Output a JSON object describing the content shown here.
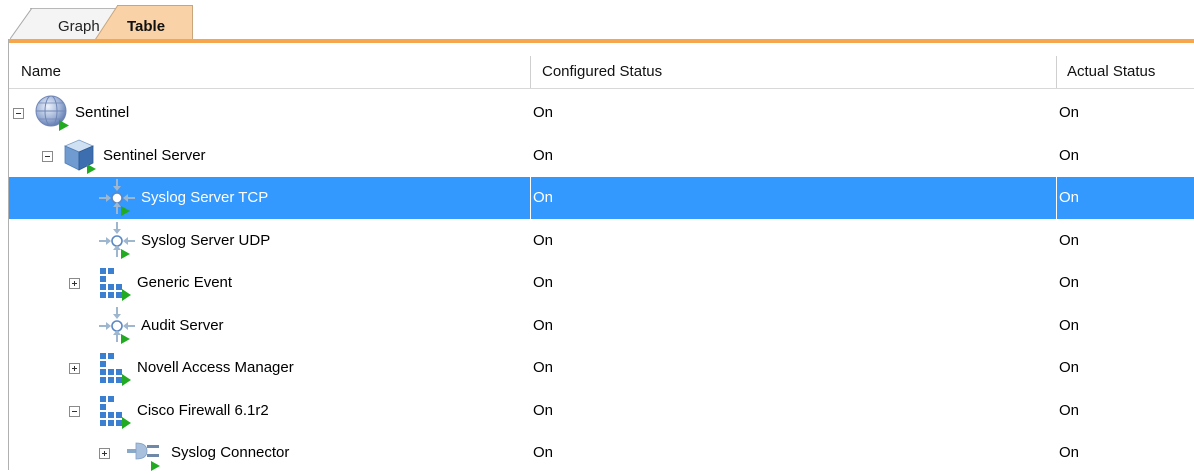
{
  "tabs": [
    {
      "label": "Graph",
      "active": false
    },
    {
      "label": "Table",
      "active": true
    }
  ],
  "columns": [
    "Name",
    "Configured Status",
    "Actual Status"
  ],
  "rows": [
    {
      "name": "Sentinel",
      "configured": "On",
      "actual": "On",
      "icon": "globe-icon",
      "level": 0,
      "toggle": "collapse",
      "selected": false
    },
    {
      "name": "Sentinel Server",
      "configured": "On",
      "actual": "On",
      "icon": "server-cube-icon",
      "level": 1,
      "toggle": "collapse",
      "selected": false
    },
    {
      "name": "Syslog Server TCP",
      "configured": "On",
      "actual": "On",
      "icon": "event-source-server-icon",
      "level": 2,
      "toggle": "none",
      "selected": true
    },
    {
      "name": "Syslog Server UDP",
      "configured": "On",
      "actual": "On",
      "icon": "event-source-server-icon",
      "level": 2,
      "toggle": "none",
      "selected": false
    },
    {
      "name": "Generic Event",
      "configured": "On",
      "actual": "On",
      "icon": "collector-grid-icon",
      "level": 2,
      "toggle": "expand",
      "selected": false
    },
    {
      "name": "Audit Server",
      "configured": "On",
      "actual": "On",
      "icon": "event-source-server-icon",
      "level": 2,
      "toggle": "none",
      "selected": false
    },
    {
      "name": "Novell Access Manager",
      "configured": "On",
      "actual": "On",
      "icon": "collector-grid-icon",
      "level": 2,
      "toggle": "expand",
      "selected": false
    },
    {
      "name": "Cisco Firewall 6.1r2",
      "configured": "On",
      "actual": "On",
      "icon": "collector-grid-icon",
      "level": 2,
      "toggle": "collapse",
      "selected": false
    },
    {
      "name": "Syslog Connector",
      "configured": "On",
      "actual": "On",
      "icon": "connector-plug-icon",
      "level": 3,
      "toggle": "expand",
      "selected": false
    }
  ],
  "colors": {
    "accent_orange": "#f6a64d",
    "active_tab": "#f9d3a7",
    "selection": "#3399ff",
    "run_arrow": "#22aa22"
  }
}
